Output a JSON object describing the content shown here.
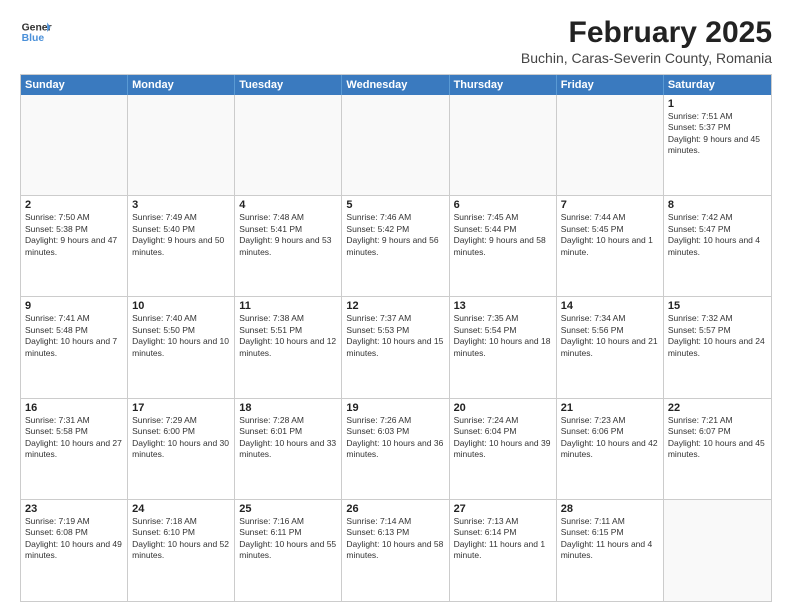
{
  "header": {
    "logo_general": "General",
    "logo_blue": "Blue",
    "month_year": "February 2025",
    "location": "Buchin, Caras-Severin County, Romania"
  },
  "weekdays": [
    "Sunday",
    "Monday",
    "Tuesday",
    "Wednesday",
    "Thursday",
    "Friday",
    "Saturday"
  ],
  "rows": [
    [
      {
        "day": "",
        "text": ""
      },
      {
        "day": "",
        "text": ""
      },
      {
        "day": "",
        "text": ""
      },
      {
        "day": "",
        "text": ""
      },
      {
        "day": "",
        "text": ""
      },
      {
        "day": "",
        "text": ""
      },
      {
        "day": "1",
        "text": "Sunrise: 7:51 AM\nSunset: 5:37 PM\nDaylight: 9 hours and 45 minutes."
      }
    ],
    [
      {
        "day": "2",
        "text": "Sunrise: 7:50 AM\nSunset: 5:38 PM\nDaylight: 9 hours and 47 minutes."
      },
      {
        "day": "3",
        "text": "Sunrise: 7:49 AM\nSunset: 5:40 PM\nDaylight: 9 hours and 50 minutes."
      },
      {
        "day": "4",
        "text": "Sunrise: 7:48 AM\nSunset: 5:41 PM\nDaylight: 9 hours and 53 minutes."
      },
      {
        "day": "5",
        "text": "Sunrise: 7:46 AM\nSunset: 5:42 PM\nDaylight: 9 hours and 56 minutes."
      },
      {
        "day": "6",
        "text": "Sunrise: 7:45 AM\nSunset: 5:44 PM\nDaylight: 9 hours and 58 minutes."
      },
      {
        "day": "7",
        "text": "Sunrise: 7:44 AM\nSunset: 5:45 PM\nDaylight: 10 hours and 1 minute."
      },
      {
        "day": "8",
        "text": "Sunrise: 7:42 AM\nSunset: 5:47 PM\nDaylight: 10 hours and 4 minutes."
      }
    ],
    [
      {
        "day": "9",
        "text": "Sunrise: 7:41 AM\nSunset: 5:48 PM\nDaylight: 10 hours and 7 minutes."
      },
      {
        "day": "10",
        "text": "Sunrise: 7:40 AM\nSunset: 5:50 PM\nDaylight: 10 hours and 10 minutes."
      },
      {
        "day": "11",
        "text": "Sunrise: 7:38 AM\nSunset: 5:51 PM\nDaylight: 10 hours and 12 minutes."
      },
      {
        "day": "12",
        "text": "Sunrise: 7:37 AM\nSunset: 5:53 PM\nDaylight: 10 hours and 15 minutes."
      },
      {
        "day": "13",
        "text": "Sunrise: 7:35 AM\nSunset: 5:54 PM\nDaylight: 10 hours and 18 minutes."
      },
      {
        "day": "14",
        "text": "Sunrise: 7:34 AM\nSunset: 5:56 PM\nDaylight: 10 hours and 21 minutes."
      },
      {
        "day": "15",
        "text": "Sunrise: 7:32 AM\nSunset: 5:57 PM\nDaylight: 10 hours and 24 minutes."
      }
    ],
    [
      {
        "day": "16",
        "text": "Sunrise: 7:31 AM\nSunset: 5:58 PM\nDaylight: 10 hours and 27 minutes."
      },
      {
        "day": "17",
        "text": "Sunrise: 7:29 AM\nSunset: 6:00 PM\nDaylight: 10 hours and 30 minutes."
      },
      {
        "day": "18",
        "text": "Sunrise: 7:28 AM\nSunset: 6:01 PM\nDaylight: 10 hours and 33 minutes."
      },
      {
        "day": "19",
        "text": "Sunrise: 7:26 AM\nSunset: 6:03 PM\nDaylight: 10 hours and 36 minutes."
      },
      {
        "day": "20",
        "text": "Sunrise: 7:24 AM\nSunset: 6:04 PM\nDaylight: 10 hours and 39 minutes."
      },
      {
        "day": "21",
        "text": "Sunrise: 7:23 AM\nSunset: 6:06 PM\nDaylight: 10 hours and 42 minutes."
      },
      {
        "day": "22",
        "text": "Sunrise: 7:21 AM\nSunset: 6:07 PM\nDaylight: 10 hours and 45 minutes."
      }
    ],
    [
      {
        "day": "23",
        "text": "Sunrise: 7:19 AM\nSunset: 6:08 PM\nDaylight: 10 hours and 49 minutes."
      },
      {
        "day": "24",
        "text": "Sunrise: 7:18 AM\nSunset: 6:10 PM\nDaylight: 10 hours and 52 minutes."
      },
      {
        "day": "25",
        "text": "Sunrise: 7:16 AM\nSunset: 6:11 PM\nDaylight: 10 hours and 55 minutes."
      },
      {
        "day": "26",
        "text": "Sunrise: 7:14 AM\nSunset: 6:13 PM\nDaylight: 10 hours and 58 minutes."
      },
      {
        "day": "27",
        "text": "Sunrise: 7:13 AM\nSunset: 6:14 PM\nDaylight: 11 hours and 1 minute."
      },
      {
        "day": "28",
        "text": "Sunrise: 7:11 AM\nSunset: 6:15 PM\nDaylight: 11 hours and 4 minutes."
      },
      {
        "day": "",
        "text": ""
      }
    ]
  ]
}
